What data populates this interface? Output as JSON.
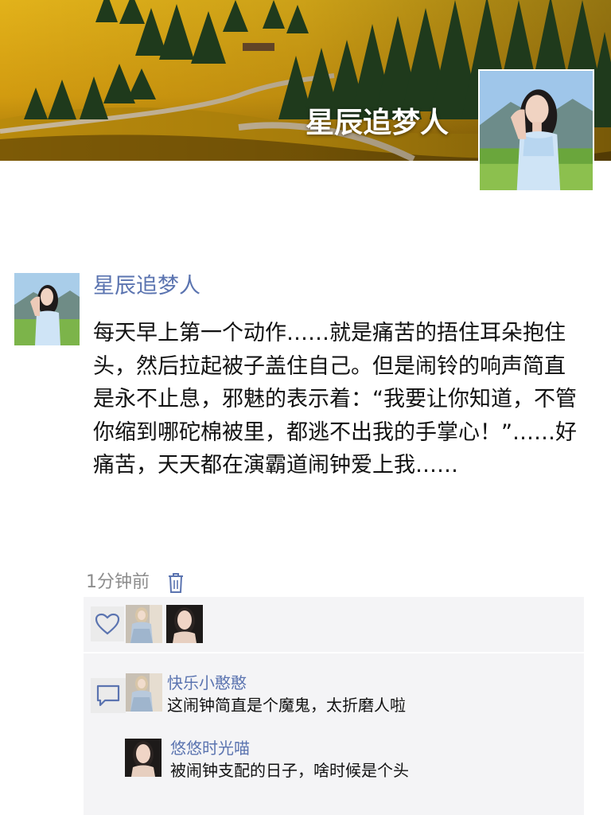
{
  "cover": {
    "user_name": "星辰追梦人"
  },
  "post": {
    "author": "星辰追梦人",
    "text": "每天早上第一个动作……就是痛苦的捂住耳朵抱住头，然后拉起被子盖住自己。但是闹铃的响声简直是永不止息，邪魅的表示着：“我要让你知道，不管你缩到哪砣棉被里，都逃不出我的手掌心！”……好痛苦，天天都在演霸道闹钟爱上我……",
    "time": "1分钟前"
  },
  "likes": {
    "count_shown": 2
  },
  "comments": [
    {
      "name": "快乐小憨憨",
      "text": "这闹钟简直是个魔鬼，太折磨人啦"
    },
    {
      "name": "悠悠时光喵",
      "text": "被闹钟支配的日子，啥时候是个头"
    }
  ],
  "colors": {
    "link_blue": "#5b74b0",
    "panel_bg": "#f4f4f6",
    "time_gray": "#8c8c8c"
  },
  "icons": [
    "heart-icon",
    "comment-icon",
    "trash-icon"
  ]
}
